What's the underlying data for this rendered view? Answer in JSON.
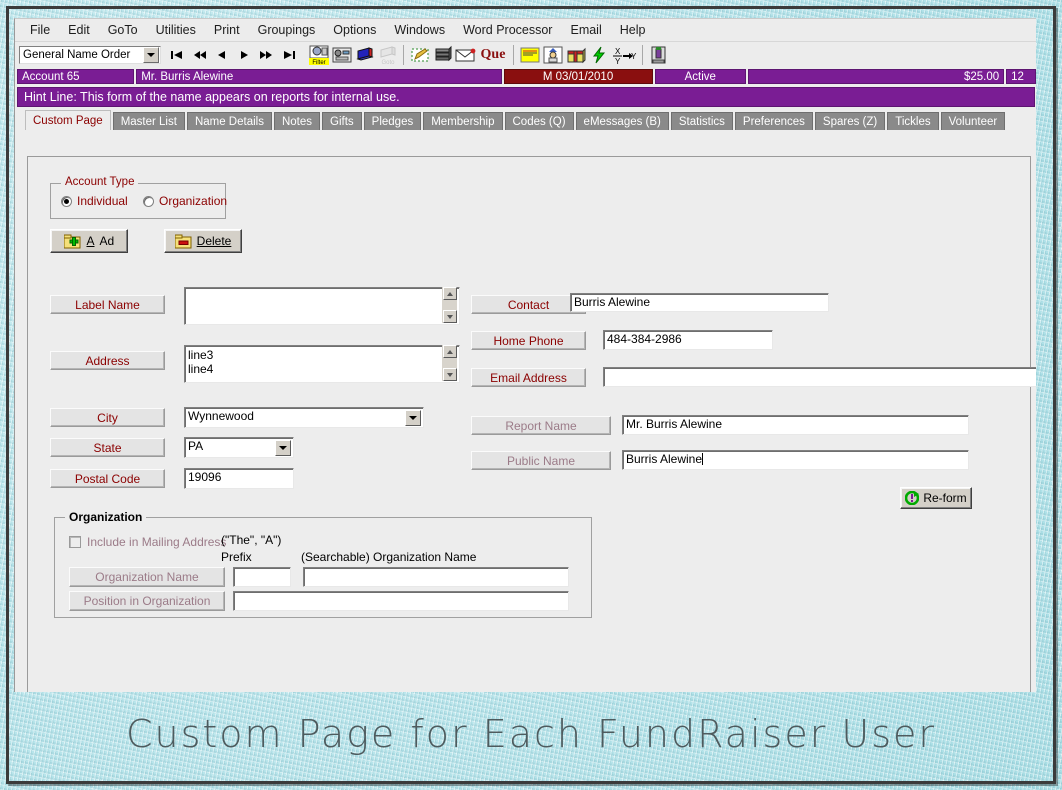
{
  "menu": {
    "items": [
      "File",
      "Edit",
      "GoTo",
      "Utilities",
      "Print",
      "Groupings",
      "Options",
      "Windows",
      "Word Processor",
      "Email",
      "Help"
    ]
  },
  "toolbar": {
    "order_combo_value": "General Name Order",
    "nav": [
      {
        "name": "first-record-button",
        "glyph": "|◀"
      },
      {
        "name": "prev-page-button",
        "glyph": "◀◀"
      },
      {
        "name": "prev-record-button",
        "glyph": "◀"
      },
      {
        "name": "next-record-button",
        "glyph": "▶"
      },
      {
        "name": "next-page-button",
        "glyph": "▶▶"
      },
      {
        "name": "last-record-button",
        "glyph": "▶|"
      }
    ],
    "icons": [
      {
        "name": "filter-icon",
        "label": "Filter"
      },
      {
        "name": "goto-record-icon",
        "label": ""
      },
      {
        "name": "book-icon",
        "label": ""
      },
      {
        "name": "goto-icon",
        "label": "Goto"
      },
      {
        "name": "edit-pencil-icon",
        "label": ""
      },
      {
        "name": "database-icon",
        "label": ""
      },
      {
        "name": "envelope-icon",
        "label": ""
      },
      {
        "name": "que-icon",
        "label": "Que"
      },
      {
        "name": "notepad-icon",
        "label": ""
      },
      {
        "name": "volunteer-icon",
        "label": ""
      },
      {
        "name": "gift-icon",
        "label": ""
      },
      {
        "name": "lightning-icon",
        "label": ""
      },
      {
        "name": "crosstab-icon",
        "label": "X→Y"
      },
      {
        "name": "exit-icon",
        "label": ""
      }
    ]
  },
  "status_strip": {
    "account": "Account 65",
    "name": "Mr. Burris Alewine",
    "date": "M 03/01/2010",
    "state": "Active",
    "amount": "$25.00",
    "extra": "12"
  },
  "hint": {
    "text": "Hint Line:  This form of the name appears on reports for internal use."
  },
  "tabs": [
    {
      "label": "Custom Page",
      "active": true
    },
    {
      "label": "Master List",
      "active": false
    },
    {
      "label": "Name Details",
      "active": false
    },
    {
      "label": "Notes",
      "active": false
    },
    {
      "label": "Gifts",
      "active": false
    },
    {
      "label": "Pledges",
      "active": false
    },
    {
      "label": "Membership",
      "active": false
    },
    {
      "label": "Codes  (Q)",
      "active": false
    },
    {
      "label": "eMessages  (B)",
      "active": false
    },
    {
      "label": "Statistics",
      "active": false
    },
    {
      "label": "Preferences",
      "active": false
    },
    {
      "label": "Spares (Z)",
      "active": false
    },
    {
      "label": "Tickles",
      "active": false
    },
    {
      "label": "Volunteer",
      "active": false
    }
  ],
  "account_type": {
    "title": "Account Type",
    "individual_label": "Individual",
    "organization_label": "Organization",
    "selected": "Individual"
  },
  "actions": {
    "add_label": "Add",
    "delete_label": "Delete",
    "reform_label": "Re-form"
  },
  "left_fields": {
    "label_name_label": "Label Name",
    "label_name_value": "",
    "address_label": "Address",
    "address_value": "line3\nline4",
    "city_label": "City",
    "city_value": "Wynnewood",
    "state_label": "State",
    "state_value": "PA",
    "postal_label": "Postal Code",
    "postal_value": "19096"
  },
  "right_fields": {
    "contact_label": "Contact",
    "contact_value": "Burris Alewine",
    "home_phone_label": "Home Phone",
    "home_phone_value": "484-384-2986",
    "email_label": "Email Address",
    "email_value": "",
    "report_name_label": "Report Name",
    "report_name_value": "Mr. Burris Alewine",
    "public_name_label": "Public Name",
    "public_name_value": "Burris Alewine"
  },
  "organization": {
    "title": "Organization",
    "include_label": "Include in Mailing Address",
    "include_checked": false,
    "the_a_note": "(\"The\", \"A\")",
    "prefix_label": "Prefix",
    "prefix_value": "",
    "searchable_label": "(Searchable) Organization Name",
    "org_name_label": "Organization Name",
    "org_name_value": "",
    "position_label": "Position in Organization",
    "position_value": ""
  },
  "caption": {
    "text": "Custom Page for Each FundRaiser User"
  },
  "colors": {
    "purple": "#7a1d94",
    "dark_red": "#8a0f0f",
    "label_red": "#8b0000",
    "tab_gray": "#8a8a8a",
    "bg_blue": "#bbe6ec"
  }
}
